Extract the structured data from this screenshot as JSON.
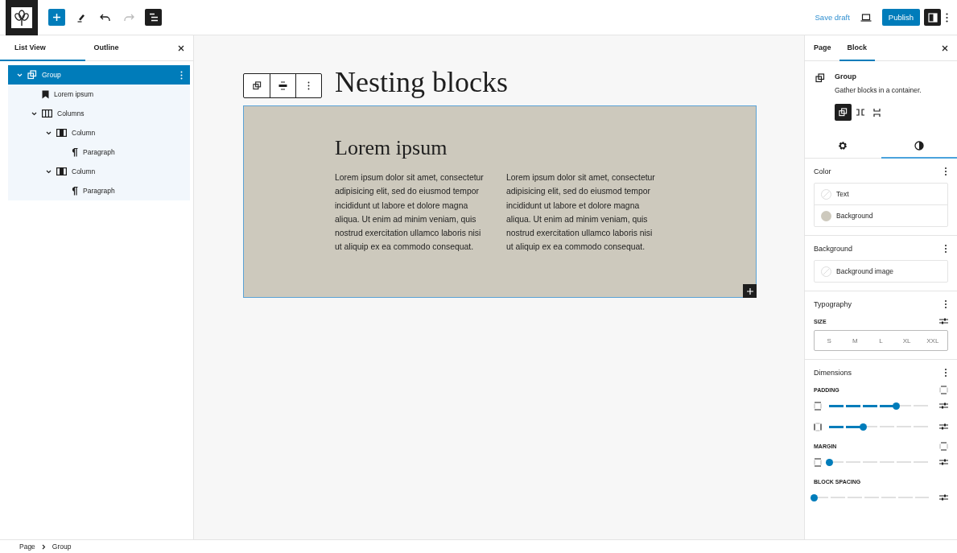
{
  "top_bar": {
    "tools": [
      {
        "kind": "inserter"
      },
      {
        "kind": "tools",
        "disabled": false
      },
      {
        "kind": "undo",
        "disabled": false
      },
      {
        "kind": "redo",
        "disabled": true
      },
      {
        "kind": "list-view"
      }
    ],
    "save_draft": "Save draft",
    "publish": "Publish"
  },
  "list_panel": {
    "tabs": [
      {
        "label": "List View",
        "selected": true
      },
      {
        "label": "Outline",
        "selected": false
      }
    ],
    "tree": [
      {
        "label": "Group",
        "kind": "group",
        "selected": true,
        "expanded": true,
        "children": [
          {
            "label": "Lorem ipsum",
            "kind": "heading",
            "selected": false
          },
          {
            "label": "Columns",
            "kind": "columns",
            "selected": false,
            "expanded": true,
            "children": [
              {
                "label": "Column",
                "kind": "column",
                "selected": false,
                "expanded": true,
                "children": [
                  {
                    "label": "Paragraph",
                    "kind": "paragraph",
                    "selected": false
                  }
                ]
              },
              {
                "label": "Column",
                "kind": "column",
                "selected": false,
                "expanded": true,
                "children": [
                  {
                    "label": "Paragraph",
                    "kind": "paragraph",
                    "selected": false
                  }
                ]
              }
            ]
          }
        ]
      }
    ]
  },
  "canvas": {
    "title": "Nesting blocks",
    "heading": "Lorem ipsum",
    "columns": [
      "Lorem ipsum dolor sit amet, consectetur adipisicing elit, sed do eiusmod tempor incididunt ut labore et dolore magna aliqua. Ut enim ad minim veniam, quis nostrud exercitation ullamco laboris nisi ut aliquip ex ea commodo consequat.",
      "Lorem ipsum dolor sit amet, consectetur adipisicing elit, sed do eiusmod tempor incididunt ut labore et dolore magna aliqua. Ut enim ad minim veniam, quis nostrud exercitation ullamco laboris nisi ut aliquip ex ea commodo consequat."
    ]
  },
  "inspector": {
    "tabs": [
      {
        "label": "Page",
        "selected": false
      },
      {
        "label": "Block",
        "selected": true
      }
    ],
    "block": {
      "name": "Group",
      "description": "Gather blocks in a container.",
      "variations": [
        {
          "kind": "group",
          "selected": true
        },
        {
          "kind": "row",
          "selected": false
        },
        {
          "kind": "stack",
          "selected": false
        }
      ]
    },
    "sub_tabs": [
      {
        "kind": "settings",
        "selected": false
      },
      {
        "kind": "styles",
        "selected": true
      }
    ],
    "color": {
      "title": "Color",
      "items": [
        {
          "label": "Text"
        },
        {
          "label": "Background",
          "color": "#cdc9bd"
        }
      ]
    },
    "background": {
      "title": "Background",
      "items": [
        {
          "label": "Background image"
        }
      ]
    },
    "typography": {
      "title": "Typography",
      "size_label": "SIZE",
      "sizes": [
        {
          "label": "S",
          "selected": false
        },
        {
          "label": "M",
          "selected": false
        },
        {
          "label": "L",
          "selected": false
        },
        {
          "label": "XL",
          "selected": false
        },
        {
          "label": "XXL",
          "selected": false
        }
      ]
    },
    "dimensions": {
      "title": "Dimensions",
      "groups": [
        {
          "label": "PADDING",
          "sides_toggle": true,
          "sliders": [
            {
              "kind": "vertical",
              "level": 0.67
            },
            {
              "kind": "horizontal",
              "level": 0.34
            }
          ]
        },
        {
          "label": "MARGIN",
          "sides_toggle": true,
          "sliders": [
            {
              "kind": "vertical",
              "level": 0
            }
          ]
        },
        {
          "label": "BLOCK SPACING",
          "sides_toggle": false,
          "sliders": [
            {
              "kind": "plain",
              "level": 0
            }
          ]
        }
      ]
    }
  },
  "breadcrumb": [
    "Page",
    "Group"
  ]
}
